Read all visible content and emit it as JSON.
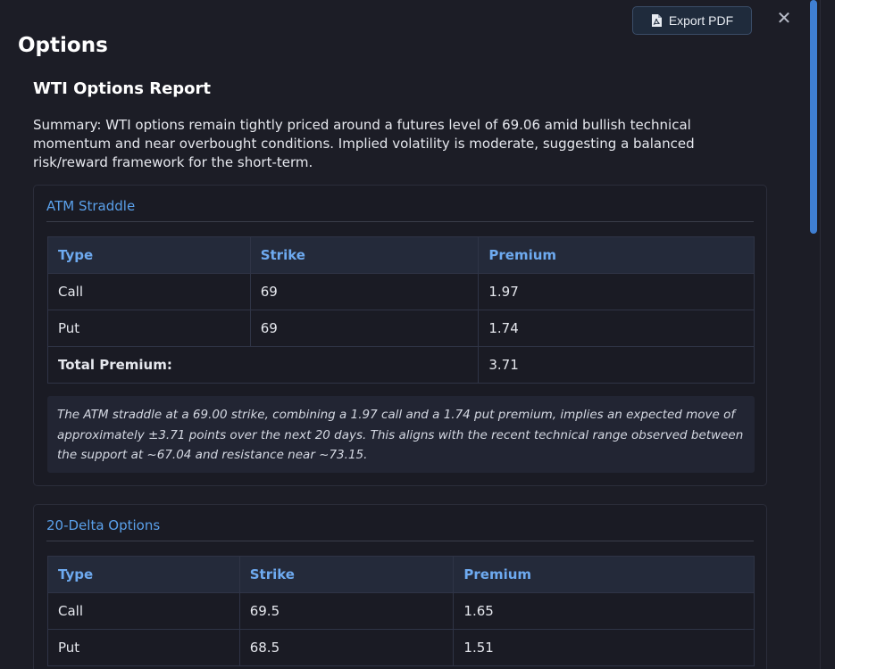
{
  "header": {
    "title": "Options",
    "export_label": "Export PDF",
    "close_symbol": "✕"
  },
  "report": {
    "title": "WTI Options Report",
    "summary": "Summary: WTI options remain tightly priced around a futures level of 69.06 amid bullish technical momentum and near overbought conditions. Implied volatility is moderate, suggesting a balanced risk/reward framework for the short-term."
  },
  "atm_straddle": {
    "title": "ATM Straddle",
    "columns": [
      "Type",
      "Strike",
      "Premium"
    ],
    "rows": [
      {
        "type": "Call",
        "strike": "69",
        "premium": "1.97"
      },
      {
        "type": "Put",
        "strike": "69",
        "premium": "1.74"
      }
    ],
    "total_label": "Total Premium:",
    "total_value": "3.71",
    "note": "The ATM straddle at a 69.00 strike, combining a 1.97 call and a 1.74 put premium, implies an expected move of approximately ±3.71 points over the next 20 days. This aligns with the recent technical range observed between the support at ~67.04 and resistance near ~73.15."
  },
  "delta_20": {
    "title": "20-Delta Options",
    "columns": [
      "Type",
      "Strike",
      "Premium"
    ],
    "rows": [
      {
        "type": "Call",
        "strike": "69.5",
        "premium": "1.65"
      },
      {
        "type": "Put",
        "strike": "68.5",
        "premium": "1.51"
      }
    ]
  },
  "icons": {
    "export": "pdf-file-icon",
    "close": "close-icon"
  },
  "colors": {
    "panel_bg": "#1c1d26",
    "accent": "#5aa0ea",
    "header_cell_bg": "#242a3a",
    "scroll_thumb": "#3f7fd2"
  }
}
